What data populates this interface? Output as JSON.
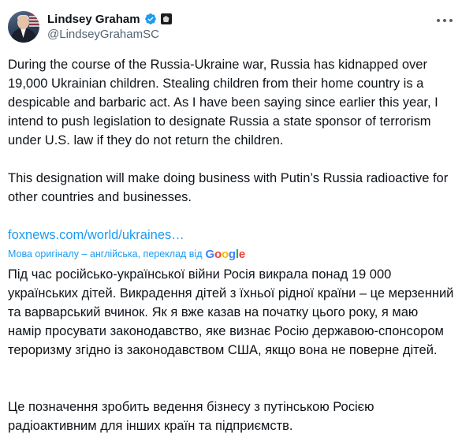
{
  "author": {
    "name": "Lindsey Graham",
    "handle": "@LindseyGrahamSC"
  },
  "tweet": {
    "paragraph_1": "During the course of the Russia-Ukraine war, Russia has kidnapped over 19,000 Ukrainian children. Stealing children from their home country is a despicable and barbaric act. As I have been saying since earlier this year, I intend to push legislation to designate Russia a state sponsor of terrorism under U.S. law if they do not return the children.",
    "paragraph_2": "This designation will make doing business with Putin’s Russia radioactive for other countries and businesses.",
    "link_text": "foxnews.com/world/ukraines…"
  },
  "translation": {
    "label": "Мова оригіналу – англійська, переклад від",
    "provider": "Google",
    "paragraph_1": "Під час російсько-української війни Росія викрала понад 19 000 українських дітей. Викрадення дітей з їхньої рідної країни – це мерзенний та варварський вчинок. Як я вже казав на початку цього року, я маю намір просувати законодавство, яке визнає Росію державою-спонсором тероризму згідно із законодавством США, якщо вона не поверне дітей.",
    "paragraph_2": "Це позначення зробить ведення бізнесу з путінською Росією радіоактивним для інших країн та підприємств."
  },
  "colors": {
    "text": "#0f1419",
    "secondary_text": "#536471",
    "link": "#1d9bf0",
    "verified_badge": "#1d9bf0"
  },
  "icons": [
    "verified-badge-icon",
    "government-affiliation-icon",
    "more-options-icon"
  ]
}
